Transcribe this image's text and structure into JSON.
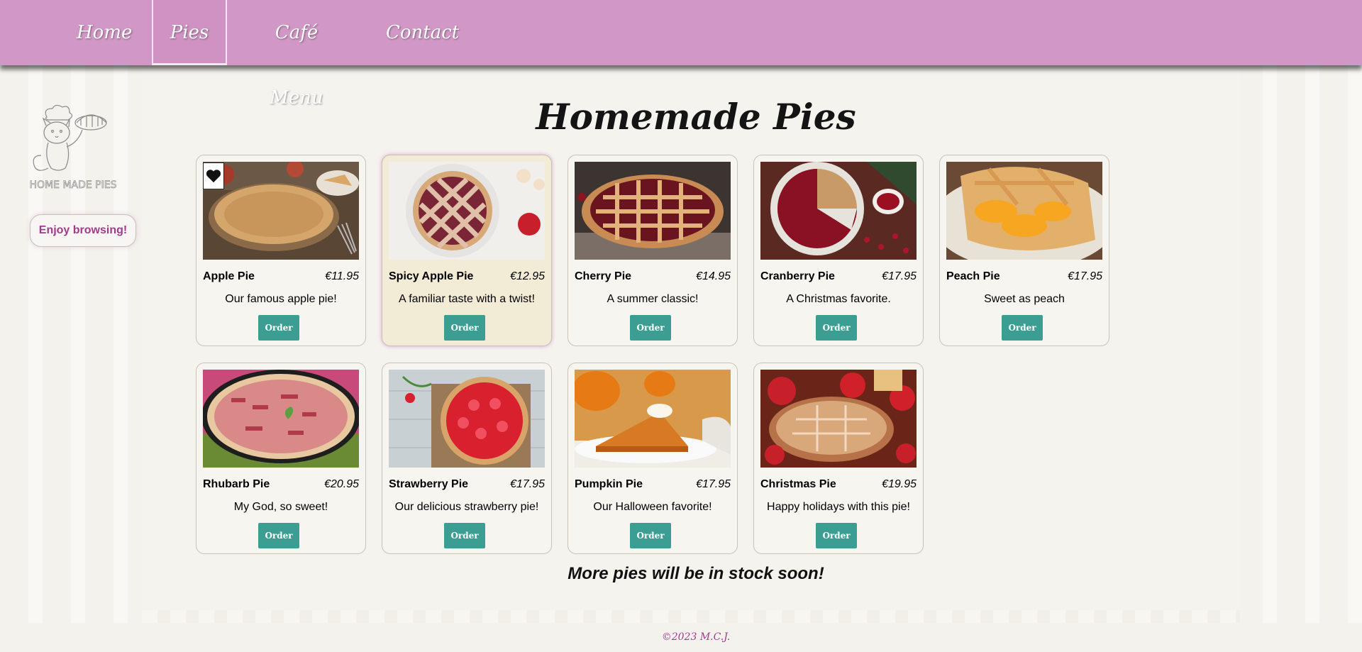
{
  "nav": {
    "items": [
      {
        "label": "Home"
      },
      {
        "label": "Pies"
      },
      {
        "label": "Café Menu"
      },
      {
        "label": "Contact"
      }
    ],
    "active": "Pies"
  },
  "sidebar": {
    "logo_text": "HOME MADE PIES",
    "enjoy_label": "Enjoy browsing!"
  },
  "page_title": "Homemade Pies",
  "pies": [
    {
      "name": "Apple Pie",
      "price": "€11.95",
      "desc": "Our famous apple pie!",
      "order": "Order"
    },
    {
      "name": "Spicy Apple Pie",
      "price": "€12.95",
      "desc": "A familiar taste with a twist!",
      "order": "Order"
    },
    {
      "name": "Cherry Pie",
      "price": "€14.95",
      "desc": "A summer classic!",
      "order": "Order"
    },
    {
      "name": "Cranberry Pie",
      "price": "€17.95",
      "desc": "A Christmas favorite.",
      "order": "Order"
    },
    {
      "name": "Peach Pie",
      "price": "€17.95",
      "desc": "Sweet as peach",
      "order": "Order"
    },
    {
      "name": "Rhubarb Pie",
      "price": "€20.95",
      "desc": "My God, so sweet!",
      "order": "Order"
    },
    {
      "name": "Strawberry Pie",
      "price": "€17.95",
      "desc": "Our delicious strawberry pie!",
      "order": "Order"
    },
    {
      "name": "Pumpkin Pie",
      "price": "€17.95",
      "desc": "Our Halloween favorite!",
      "order": "Order"
    },
    {
      "name": "Christmas Pie",
      "price": "€19.95",
      "desc": "Happy holidays with this pie!",
      "order": "Order"
    }
  ],
  "more_text": "More pies will be in stock soon!",
  "copyright": "©2023 M.C.J.",
  "colors": {
    "nav_bg": "#d197c6",
    "accent": "#a33a8c",
    "order_bg": "#3c9e92"
  }
}
